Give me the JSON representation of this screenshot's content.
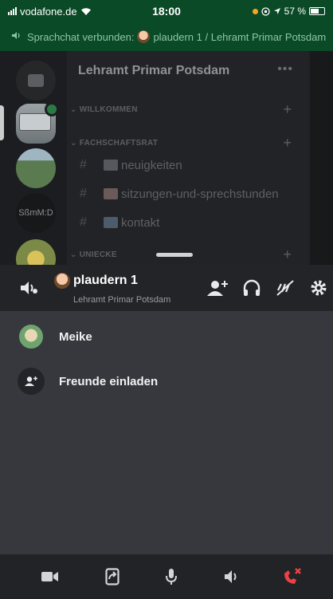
{
  "status_bar": {
    "carrier": "vodafone.de",
    "time": "18:00",
    "battery": "57 %",
    "battery_level_percent": 57
  },
  "voice_banner": {
    "text": "Sprachchat verbunden:",
    "channel": "plaudern 1 / Lehramt Primar Potsdam"
  },
  "servers": {
    "text_server_label": "SßmM:D"
  },
  "channel_panel": {
    "server_name": "Lehramt Primar Potsdam",
    "more_label": "•••",
    "categories": [
      {
        "label": "WILLKOMMEN"
      },
      {
        "label": "FACHSCHAFTSRAT"
      },
      {
        "label": "UNIECKE"
      }
    ],
    "channels": [
      {
        "name": "neuigkeiten"
      },
      {
        "name": "sitzungen-und-sprechstunden"
      },
      {
        "name": "kontakt"
      }
    ]
  },
  "voice_panel": {
    "channel_name": "plaudern 1",
    "server_name": "Lehramt Primar Potsdam",
    "members": [
      {
        "name": "Meike"
      }
    ],
    "invite_label": "Freunde einladen"
  },
  "colors": {
    "banner_green": "#0b4a27",
    "panel_dark": "#232428",
    "panel_body": "#36383d",
    "hangup_red": "#ed4245"
  },
  "icons": {
    "header": [
      "speaker-icon",
      "add-person-icon",
      "headphones-icon",
      "mute-mic-icon",
      "gear-icon"
    ],
    "bottom": [
      "camera-icon",
      "screen-share-icon",
      "microphone-icon",
      "speaker-icon",
      "hang-up-icon"
    ]
  }
}
